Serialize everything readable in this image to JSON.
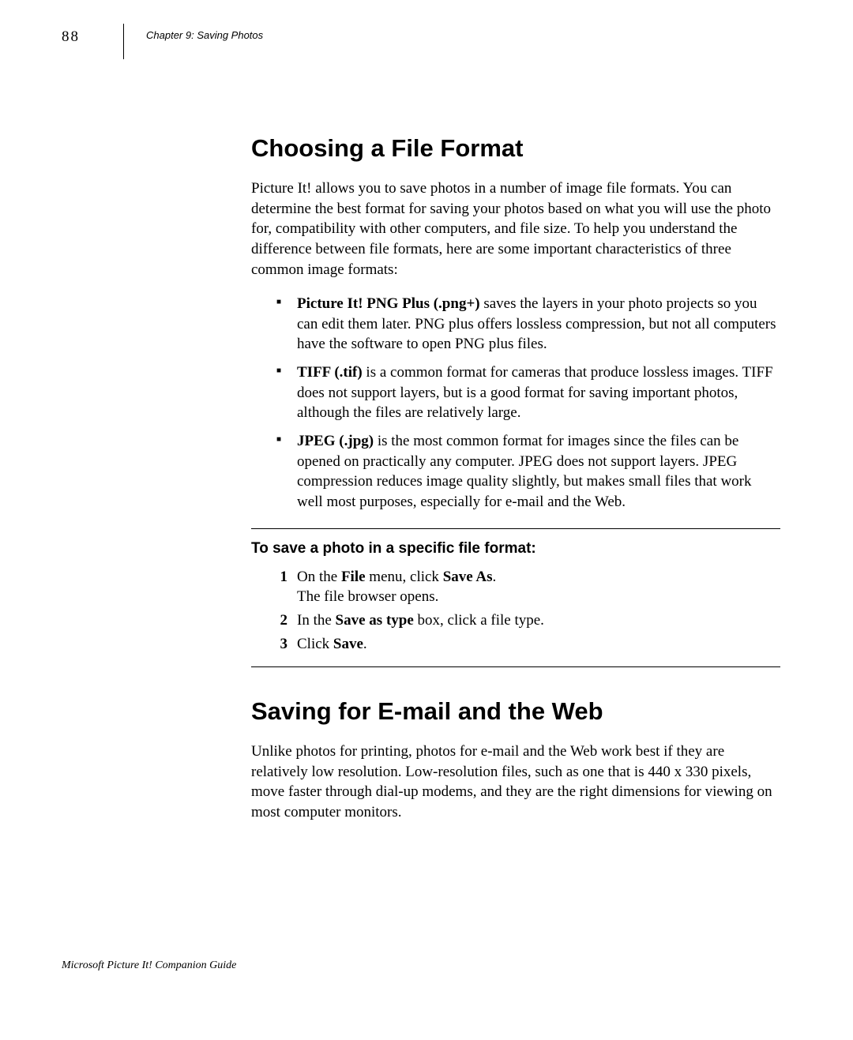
{
  "page_number": "88",
  "chapter_header": "Chapter 9: Saving Photos",
  "section1": {
    "title": "Choosing a File Format",
    "intro": "Picture It! allows you to save photos in a number of image file formats. You can determine the best format for saving your photos based on what you will use the photo for, compatibility with other computers, and file size. To help you understand the difference between file formats, here are some important characteristics of three common image formats:",
    "bullets": [
      {
        "bold": "Picture It! PNG Plus (.png+)",
        "text": " saves the layers in your photo projects so you can edit them later. PNG plus offers lossless compression, but not all computers have the software to open PNG plus files."
      },
      {
        "bold": "TIFF (.tif)",
        "text": " is a common format for cameras that produce lossless images. TIFF does not support layers, but is a good format for saving important photos, although the files are relatively large."
      },
      {
        "bold": "JPEG (.jpg)",
        "text": " is the most common format for images since the files can be opened on practically any computer. JPEG does not support layers. JPEG compression reduces image quality slightly, but makes small files that work well most purposes, especially for e-mail and the Web."
      }
    ],
    "procedure_title": "To save a photo in a specific file format:",
    "steps": {
      "s1a": "On the ",
      "s1_bold1": "File",
      "s1b": " menu, click ",
      "s1_bold2": "Save As",
      "s1c": ".",
      "s1_line2": "The file browser opens.",
      "s2a": "In the ",
      "s2_bold1": "Save as type",
      "s2b": " box, click a file type.",
      "s3a": "Click ",
      "s3_bold1": "Save",
      "s3b": "."
    }
  },
  "section2": {
    "title": "Saving for E-mail and the Web",
    "intro": "Unlike photos for printing, photos for e-mail and the Web work best if they are relatively low resolution. Low-resolution files, such as one that is 440 x 330 pixels, move faster through dial-up modems, and they are the right dimensions for viewing on most computer monitors."
  },
  "footer": "Microsoft Picture It! Companion Guide"
}
